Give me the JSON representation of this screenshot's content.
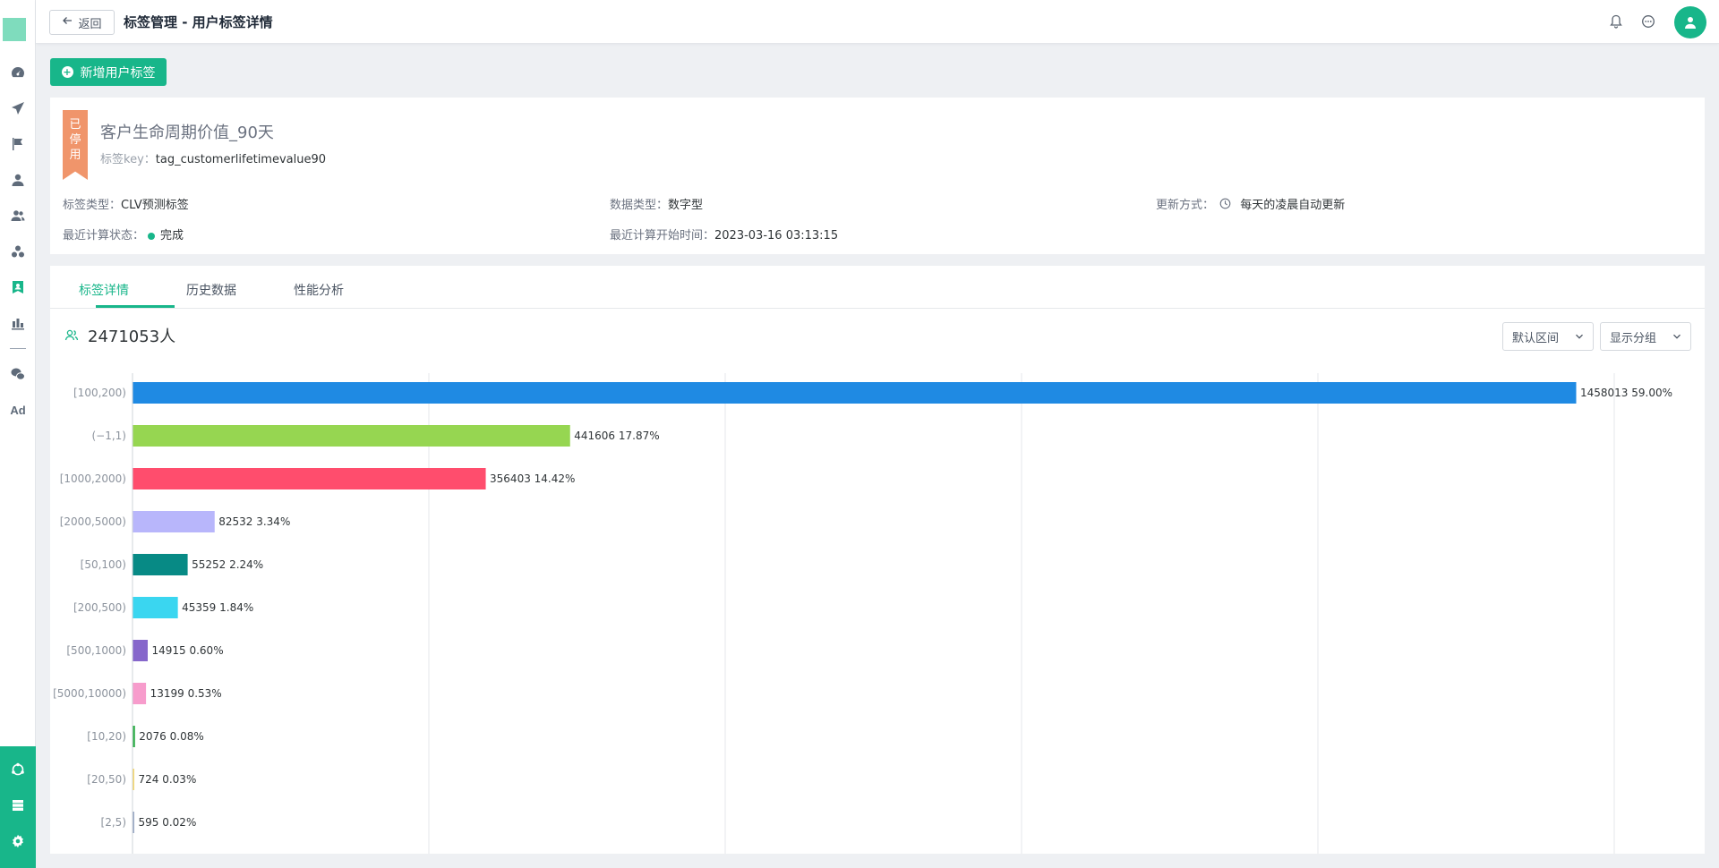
{
  "header": {
    "back_label": "返回",
    "title": "标签管理 - 用户标签详情"
  },
  "toolbar": {
    "add_label": "新增用户标签"
  },
  "sidebar": {
    "ad_label": "Ad"
  },
  "tag": {
    "status_ribbon": "已停用",
    "name": "客户生命周期价值_90天",
    "key_label": "标签key：",
    "key_value": "tag_customerlifetimevalue90",
    "type_label": "标签类型：",
    "type_value": "CLV预测标签",
    "data_type_label": "数据类型：",
    "data_type_value": "数字型",
    "update_label": "更新方式：",
    "update_value": "每天的凌晨自动更新",
    "calc_status_label": "最近计算状态：",
    "calc_status_value": "完成",
    "calc_time_label": "最近计算开始时间：",
    "calc_time_value": "2023-03-16 03:13:15"
  },
  "tabs": [
    "标签详情",
    "历史数据",
    "性能分析"
  ],
  "summary": {
    "count": "2471053人"
  },
  "controls": {
    "range_label": "默认区间",
    "group_label": "显示分组"
  },
  "chart_data": {
    "type": "bar",
    "orientation": "horizontal",
    "categories": [
      "[100,200)",
      "(−1,1)",
      "[1000,2000)",
      "[2000,5000)",
      "[50,100)",
      "[200,500)",
      "[500,1000)",
      "[5000,10000)",
      "[10,20)",
      "[20,50)",
      "[2,5)"
    ],
    "values": [
      1458013,
      441606,
      356403,
      82532,
      55252,
      45359,
      14915,
      13199,
      2076,
      724,
      595
    ],
    "percents": [
      "59.00%",
      "17.87%",
      "14.42%",
      "3.34%",
      "2.24%",
      "1.84%",
      "0.60%",
      "0.53%",
      "0.08%",
      "0.03%",
      "0.02%"
    ],
    "colors": [
      "#1f8ae3",
      "#96d651",
      "#ff4d6d",
      "#b8b6fb",
      "#078a85",
      "#3ad6f0",
      "#8667cb",
      "#f79ccc",
      "#2fae4a",
      "#f5d76e",
      "#9aa8c4"
    ],
    "xlim": [
      0,
      1500000
    ],
    "grid": true
  }
}
